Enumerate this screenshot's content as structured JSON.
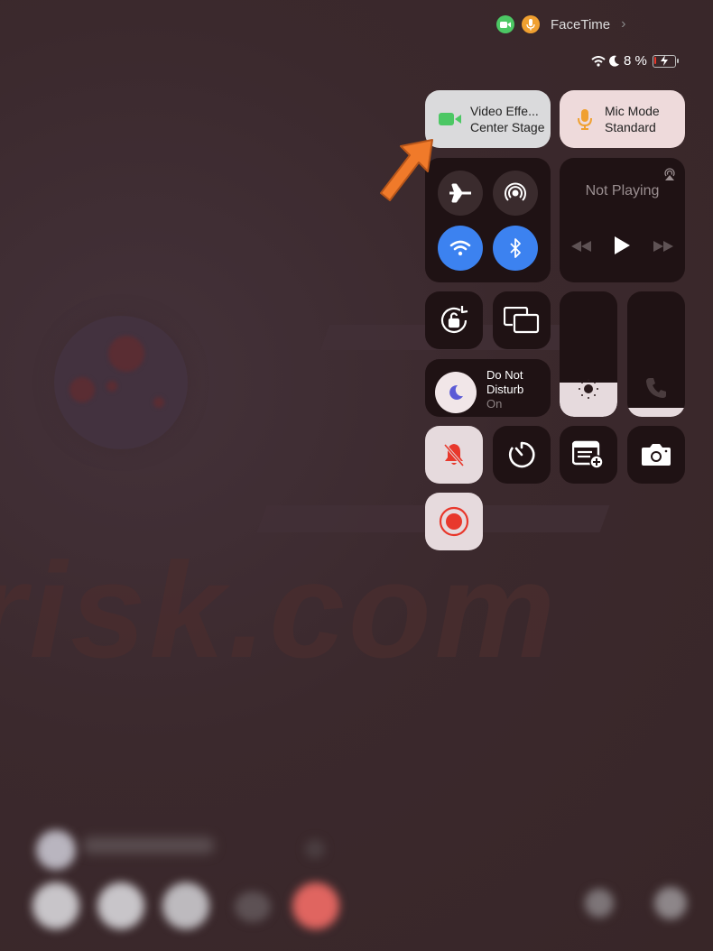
{
  "status_bar": {
    "app_label": "FaceTime",
    "camera_indicator_color": "#4cc764",
    "mic_indicator_color": "#f0a030",
    "battery_text": "8 %",
    "icons": [
      "wifi-icon",
      "moon-icon",
      "battery-charging-icon"
    ]
  },
  "watermark": {
    "text": "risk.com"
  },
  "control_center": {
    "video_effects": {
      "title": "Video Effe...",
      "subtitle": "Center Stage"
    },
    "mic_mode": {
      "title": "Mic Mode",
      "subtitle": "Standard"
    },
    "connectivity": {
      "airplane_mode": false,
      "airdrop": false,
      "wifi": true,
      "bluetooth": true
    },
    "now_playing": {
      "title": "Not Playing"
    },
    "do_not_disturb": {
      "line1": "Do Not",
      "line2": "Disturb",
      "state": "On"
    },
    "brightness_level": 0.27,
    "volume_level": 0.07,
    "tiles": [
      "orientation-lock",
      "screen-mirroring",
      "silent-mode",
      "timer",
      "quick-note",
      "camera",
      "screen-recording"
    ]
  },
  "annotation": {
    "arrow_color": "#f07a2a"
  }
}
